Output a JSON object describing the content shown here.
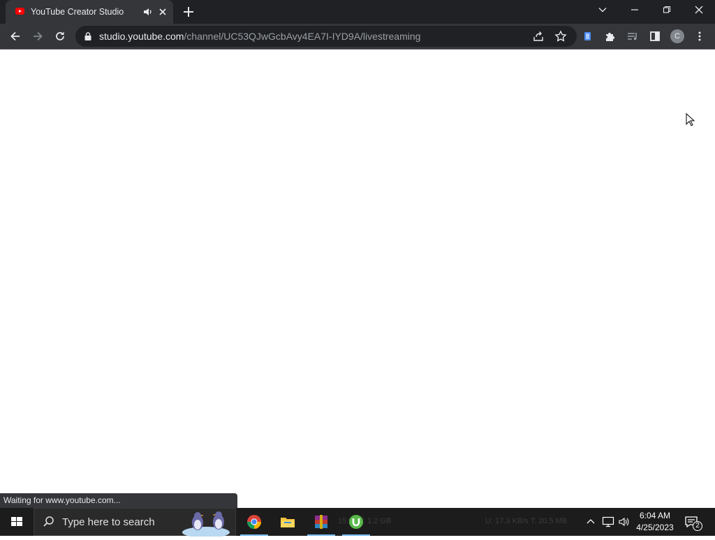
{
  "browser": {
    "tab": {
      "title": "YouTube Creator Studio"
    },
    "omnibox": {
      "host": "studio.youtube.com",
      "path": "/channel/UC53QJwGcbAvy4EA7I-IYD9A/livestreaming"
    },
    "profile_initial": "C",
    "status_text": "Waiting for www.youtube.com..."
  },
  "taskbar": {
    "search_placeholder": "Type here to search",
    "ghost_text_1": "15.92 T: 1.2 GB",
    "ghost_text_2": "U: 17.3 KB/s T: 20.5 MB",
    "clock_time": "6:04 AM",
    "clock_date": "4/25/2023",
    "notification_count": "2",
    "apps": [
      {
        "name": "chrome",
        "active": true
      },
      {
        "name": "file-explorer",
        "active": false
      },
      {
        "name": "winrar",
        "active": true
      },
      {
        "name": "utorrent",
        "active": true
      }
    ]
  },
  "colors": {
    "titlebar": "#202124",
    "tab": "#35363a",
    "omnibox": "#202124",
    "youtube_red": "#ff0000",
    "taskbar": "#1c1c1c",
    "accent_indicator": "#76b9ed"
  },
  "icons": [
    "youtube-favicon-icon",
    "speaker-icon",
    "close-icon",
    "plus-icon",
    "chevron-down-icon",
    "minimize-icon",
    "restore-icon",
    "back-arrow-icon",
    "forward-arrow-icon",
    "reload-icon",
    "lock-icon",
    "share-icon",
    "star-icon",
    "extension-doc-icon",
    "puzzle-icon",
    "media-queue-icon",
    "sidepanel-icon",
    "kebab-menu-icon",
    "windows-start-icon",
    "search-icon",
    "chrome-icon",
    "folder-icon",
    "winrar-icon",
    "utorrent-icon",
    "tray-chevron-icon",
    "network-icon",
    "volume-icon",
    "notification-icon",
    "mouse-cursor-icon"
  ]
}
